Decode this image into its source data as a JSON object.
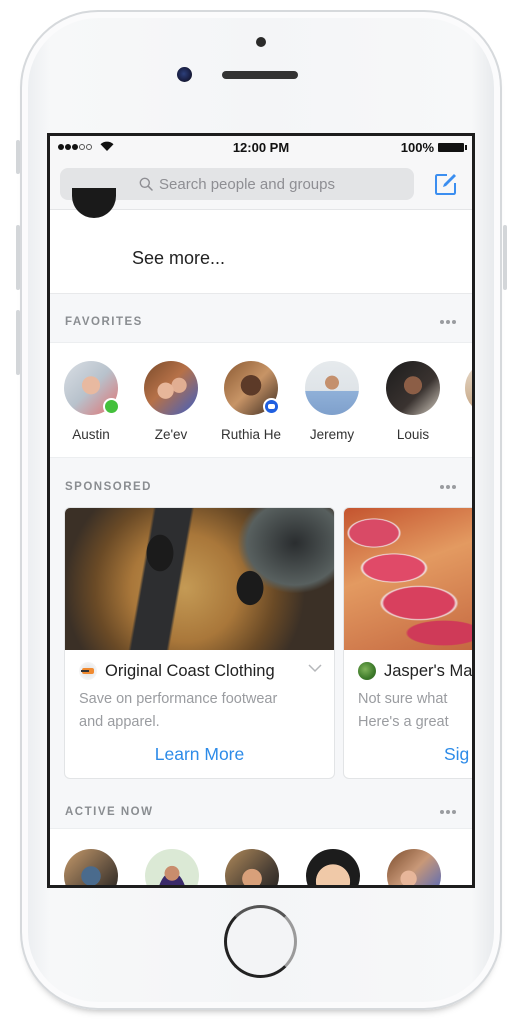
{
  "device": {
    "model": "iPhone"
  },
  "status_bar": {
    "signal_strength": 3,
    "signal_max": 5,
    "wifi": "wifi-icon",
    "time": "12:00 PM",
    "battery": "100%"
  },
  "search": {
    "placeholder": "Search people and groups",
    "icon": "search-icon",
    "compose_icon": "compose-icon",
    "accent_color": "#3b8ef0"
  },
  "top_card": {
    "see_more_label": "See more..."
  },
  "favorites": {
    "title": "FAVORITES",
    "more_icon": "more-dots-icon",
    "people": [
      {
        "name": "Austin",
        "status": "online"
      },
      {
        "name": "Ze'ev",
        "status": "none"
      },
      {
        "name": "Ruthia He",
        "status": "messenger"
      },
      {
        "name": "Jeremy",
        "status": "none"
      },
      {
        "name": "Louis",
        "status": "none"
      }
    ]
  },
  "sponsored": {
    "title": "SPONSORED",
    "more_icon": "more-dots-icon",
    "ads": [
      {
        "brand": "Original Coast Clothing",
        "text_line1": "Save on performance footwear",
        "text_line2": "and apparel.",
        "cta": "Learn More",
        "image": "shoes-on-rock-image"
      },
      {
        "brand": "Jasper's Ma",
        "text_line1": "Not sure what",
        "text_line2": "Here's a great",
        "cta": "Sig",
        "image": "radish-slices-image"
      }
    ],
    "cta_color": "#2d8be8"
  },
  "active_now": {
    "title": "ACTIVE NOW",
    "more_icon": "more-dots-icon",
    "count_visible": 5
  },
  "colors": {
    "online": "#44c03c",
    "messenger_badge": "#1f5fe0",
    "section_title": "#8a8d91"
  }
}
